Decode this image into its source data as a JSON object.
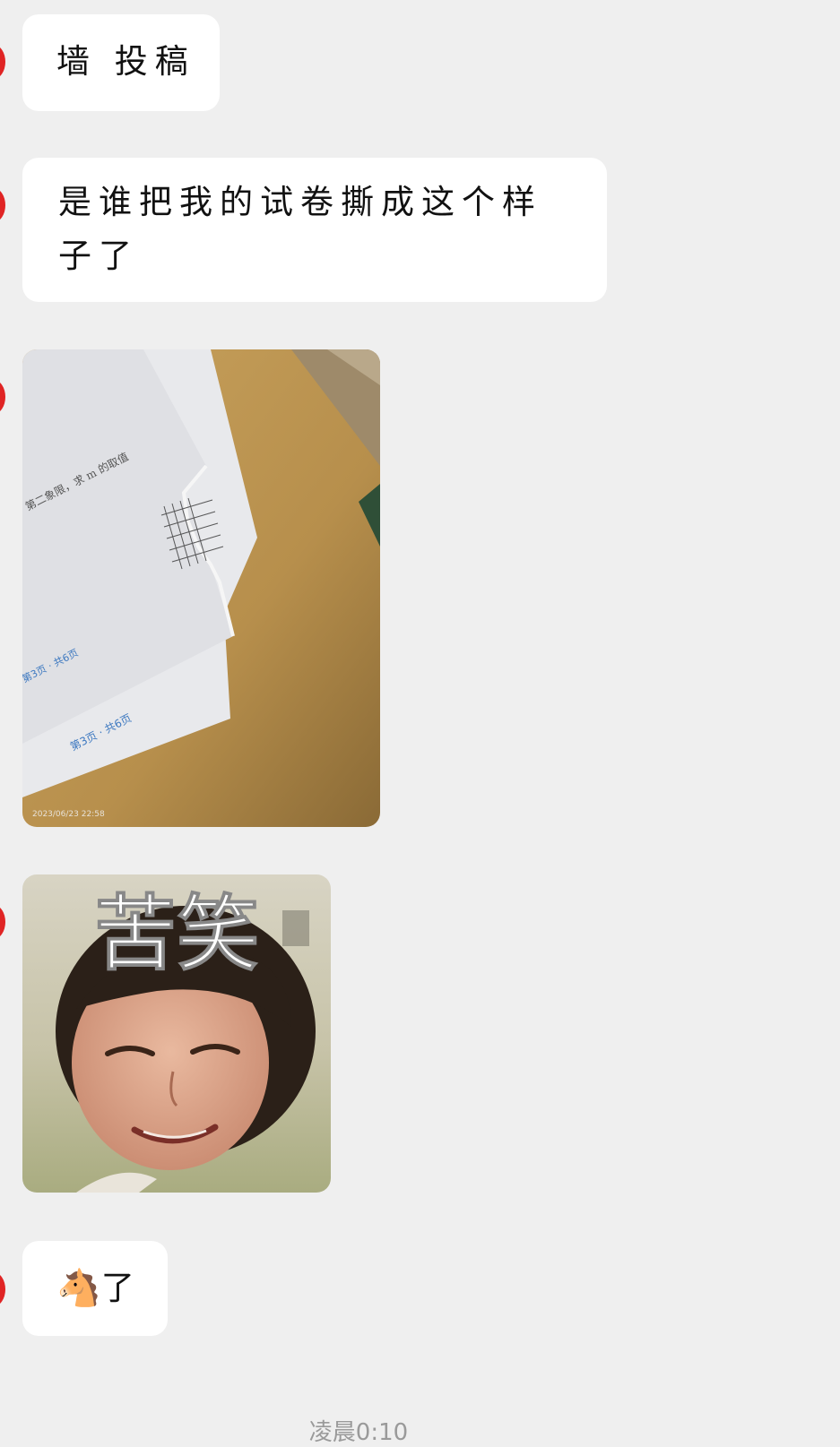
{
  "chat": {
    "messages": [
      {
        "type": "text",
        "text": "墙 投稿"
      },
      {
        "type": "text",
        "text": "是谁把我的试卷撕成这个样子了"
      },
      {
        "type": "image",
        "subject": "torn-exam-paper-photo",
        "paper_text": "第二象限，求 m 的取值",
        "page_label_1": "第3页 · 共6页",
        "page_label_2": "第3页 · 共6页",
        "photo_timestamp": "2023/06/23 22:58"
      },
      {
        "type": "sticker",
        "caption": "苦笑",
        "subject": "crying-smiling-woman"
      },
      {
        "type": "text",
        "emoji": "🐴",
        "text": "了"
      }
    ],
    "footer_time": "凌晨0:10"
  },
  "colors": {
    "background": "#efefef",
    "bubble": "#ffffff",
    "avatar_edge": "#e02424"
  }
}
